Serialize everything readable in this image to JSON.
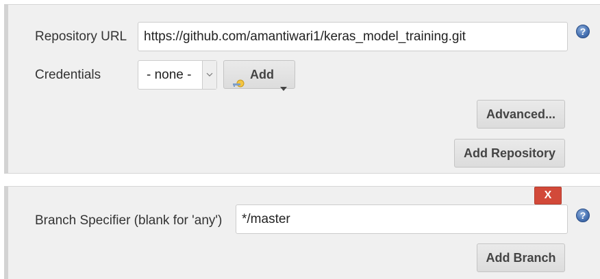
{
  "repository": {
    "url_label": "Repository URL",
    "url_value": "https://github.com/amantiwari1/keras_model_training.git",
    "credentials_label": "Credentials",
    "credentials_selected": "- none -",
    "add_label": "Add",
    "advanced_label": "Advanced...",
    "add_repository_label": "Add Repository",
    "help_symbol": "?"
  },
  "branch": {
    "delete_label": "X",
    "specifier_label": "Branch Specifier (blank for 'any')",
    "specifier_value": "*/master",
    "add_branch_label": "Add Branch",
    "help_symbol": "?"
  },
  "icons": {
    "help": "help-icon",
    "credentials_key": "key-icon",
    "dropdown": "chevron-down-icon",
    "delete": "close-icon"
  },
  "colors": {
    "panel_bg": "#f0f0f0",
    "delete_red": "#d24939",
    "help_blue": "#4a75b5"
  }
}
